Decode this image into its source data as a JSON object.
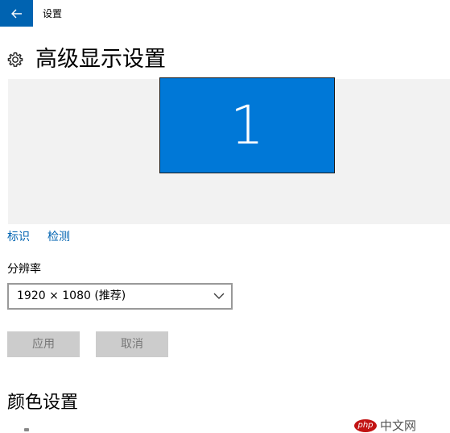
{
  "window": {
    "title": "设置",
    "back_icon": "back-arrow-icon",
    "accent": "#0063b1"
  },
  "page": {
    "title": "高级显示设置",
    "title_icon": "gear-icon"
  },
  "display": {
    "monitor_number": "1",
    "monitor_color": "#0078d7",
    "area_color": "#f2f2f2"
  },
  "links": {
    "identify": "标识",
    "detect": "检测",
    "color": "#0063b1"
  },
  "resolution": {
    "label": "分辨率",
    "value": "1920 × 1080 (推荐)"
  },
  "buttons": {
    "apply": "应用",
    "cancel": "取消",
    "disabled_bg": "#cccccc"
  },
  "color_section": {
    "title": "颜色设置"
  },
  "watermark": {
    "logo": "php",
    "text": "中文网"
  }
}
